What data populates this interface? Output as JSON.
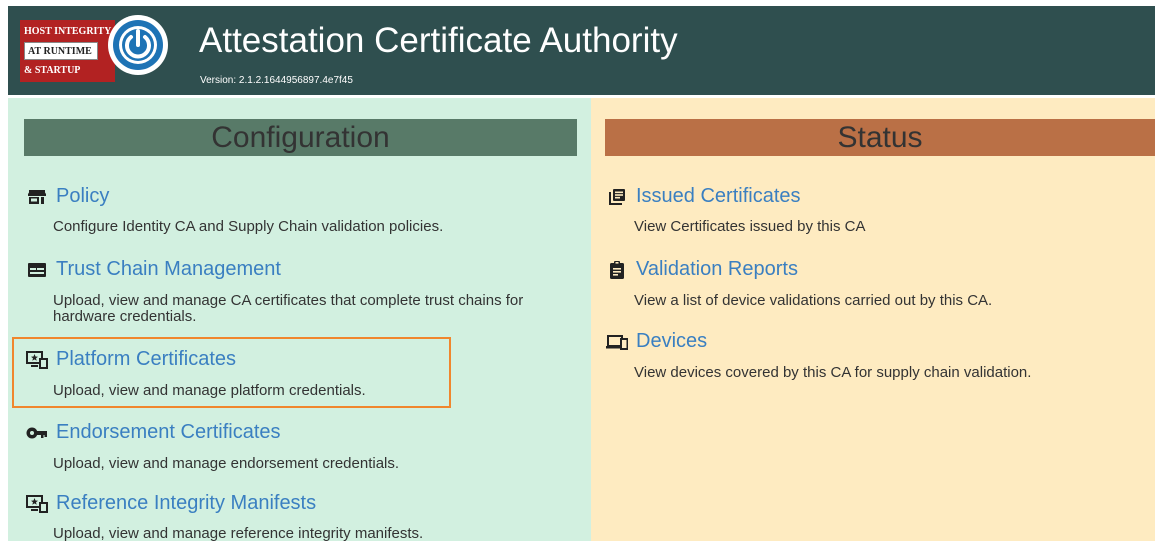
{
  "header": {
    "logo": {
      "line1": "HOST INTEGRITY",
      "line2": "AT RUNTIME",
      "line3": "& STARTUP",
      "icon": "power-icon"
    },
    "title": "Attestation Certificate Authority",
    "version": "Version: 2.1.2.1644956897.4e7f45"
  },
  "configuration": {
    "heading": "Configuration",
    "items": [
      {
        "label": "Policy",
        "icon": "store-icon",
        "description": "Configure Identity CA and Supply Chain validation policies."
      },
      {
        "label": "Trust Chain Management",
        "icon": "chain-card-icon",
        "description": "Upload, view and manage CA certificates that complete trust chains for hardware credentials."
      },
      {
        "label": "Platform Certificates",
        "icon": "platform-cert-icon",
        "description": "Upload, view and manage platform credentials."
      },
      {
        "label": "Endorsement Certificates",
        "icon": "key-icon",
        "description": "Upload, view and manage endorsement credentials."
      },
      {
        "label": "Reference Integrity Manifests",
        "icon": "platform-cert-icon",
        "description": "Upload, view and manage reference integrity manifests."
      }
    ]
  },
  "status": {
    "heading": "Status",
    "items": [
      {
        "label": "Issued Certificates",
        "icon": "library-books-icon",
        "description": "View Certificates issued by this CA"
      },
      {
        "label": "Validation Reports",
        "icon": "assignment-icon",
        "description": "View a list of device validations carried out by this CA."
      },
      {
        "label": "Devices",
        "icon": "devices-icon",
        "description": "View devices covered by this CA for supply chain validation."
      }
    ]
  },
  "colors": {
    "header_bg": "#2f4f4f",
    "config_bg": "#d2f0e0",
    "status_bg": "#feebc1",
    "config_band": "#587a68",
    "status_band": "#ba7046",
    "link": "#3a7fc1",
    "highlight_border": "#f0862d"
  }
}
